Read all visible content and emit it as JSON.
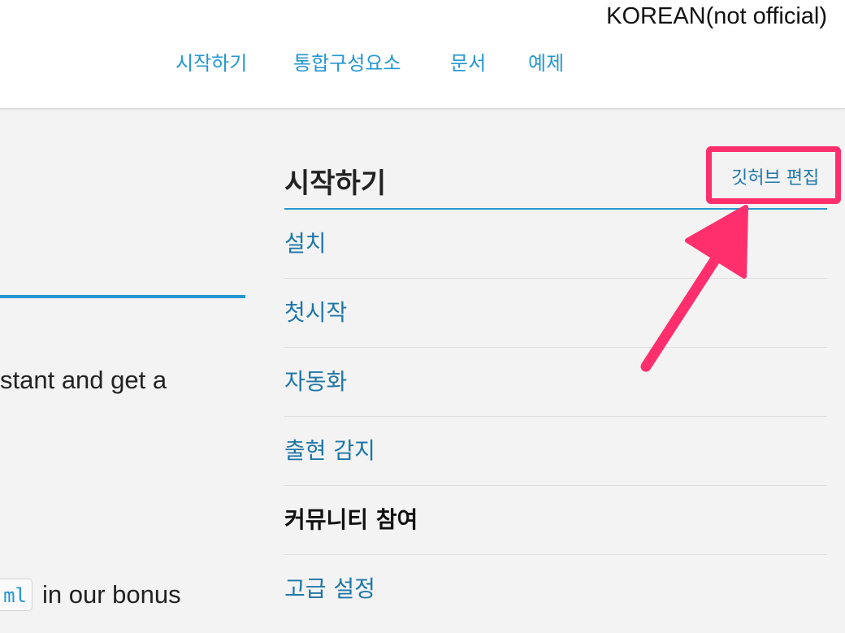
{
  "header": {
    "language": "KOREAN(not official)",
    "nav": [
      "시작하기",
      "통합구성요소",
      "문서",
      "예제"
    ]
  },
  "main": {
    "text_line_1": "stant and get a",
    "code_snippet": "ml",
    "text_line_2": "in our bonus"
  },
  "sidebar": {
    "title": "시작하기",
    "edit_link": "깃허브 편집",
    "items": [
      {
        "label": "설치",
        "active": false
      },
      {
        "label": "첫시작",
        "active": false
      },
      {
        "label": "자동화",
        "active": false
      },
      {
        "label": "출현 감지",
        "active": false
      },
      {
        "label": "커뮤니티 참여",
        "active": true
      },
      {
        "label": "고급 설정",
        "active": false
      }
    ]
  },
  "colors": {
    "accent": "#2597d1",
    "link": "#1f77a8",
    "annotation": "#ff2f6e"
  },
  "annotation": {
    "icon": "pointer-arrow-icon"
  }
}
